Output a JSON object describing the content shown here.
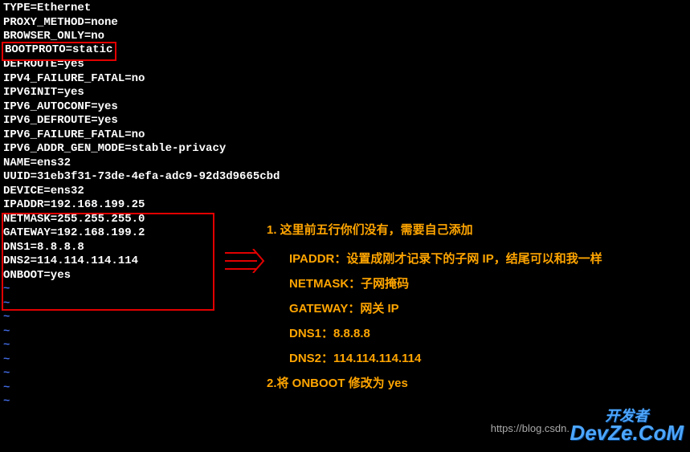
{
  "config": {
    "lines": [
      "TYPE=Ethernet",
      "PROXY_METHOD=none",
      "BROWSER_ONLY=no",
      "BOOTPROTO=static",
      "DEFROUTE=yes",
      "IPV4_FAILURE_FATAL=no",
      "IPV6INIT=yes",
      "IPV6_AUTOCONF=yes",
      "IPV6_DEFROUTE=yes",
      "IPV6_FAILURE_FATAL=no",
      "IPV6_ADDR_GEN_MODE=stable-privacy",
      "NAME=ens32",
      "UUID=31eb3f31-73de-4efa-adc9-92d3d9665cbd",
      "DEVICE=ens32",
      "IPADDR=192.168.199.25",
      "NETMASK=255.255.255.0",
      "GATEWAY=192.168.199.2",
      "DNS1=8.8.8.8",
      "DNS2=114.114.114.114",
      "ONBOOT=yes"
    ],
    "highlight_line": "BOOTPROTO=static",
    "tildes": [
      "~",
      "~",
      "~",
      "~",
      "~",
      "~",
      "~",
      "~",
      "~"
    ]
  },
  "annotation": {
    "title1": "1.   这里前五行你们没有，需要自己添加",
    "ipaddr": "IPADDR：设置成刚才记录下的子网 IP，结尾可以和我一样",
    "netmask": "NETMASK：子网掩码",
    "gateway": "GATEWAY：网关 IP",
    "dns1": "DNS1：8.8.8.8",
    "dns2": "DNS2：114.114.114.114",
    "title2": "2.将 ONBOOT 修改为 yes"
  },
  "watermark": {
    "url": "https://blog.csdn.",
    "logo_cn": "开发者",
    "logo_en": "DevZe.CoM"
  }
}
